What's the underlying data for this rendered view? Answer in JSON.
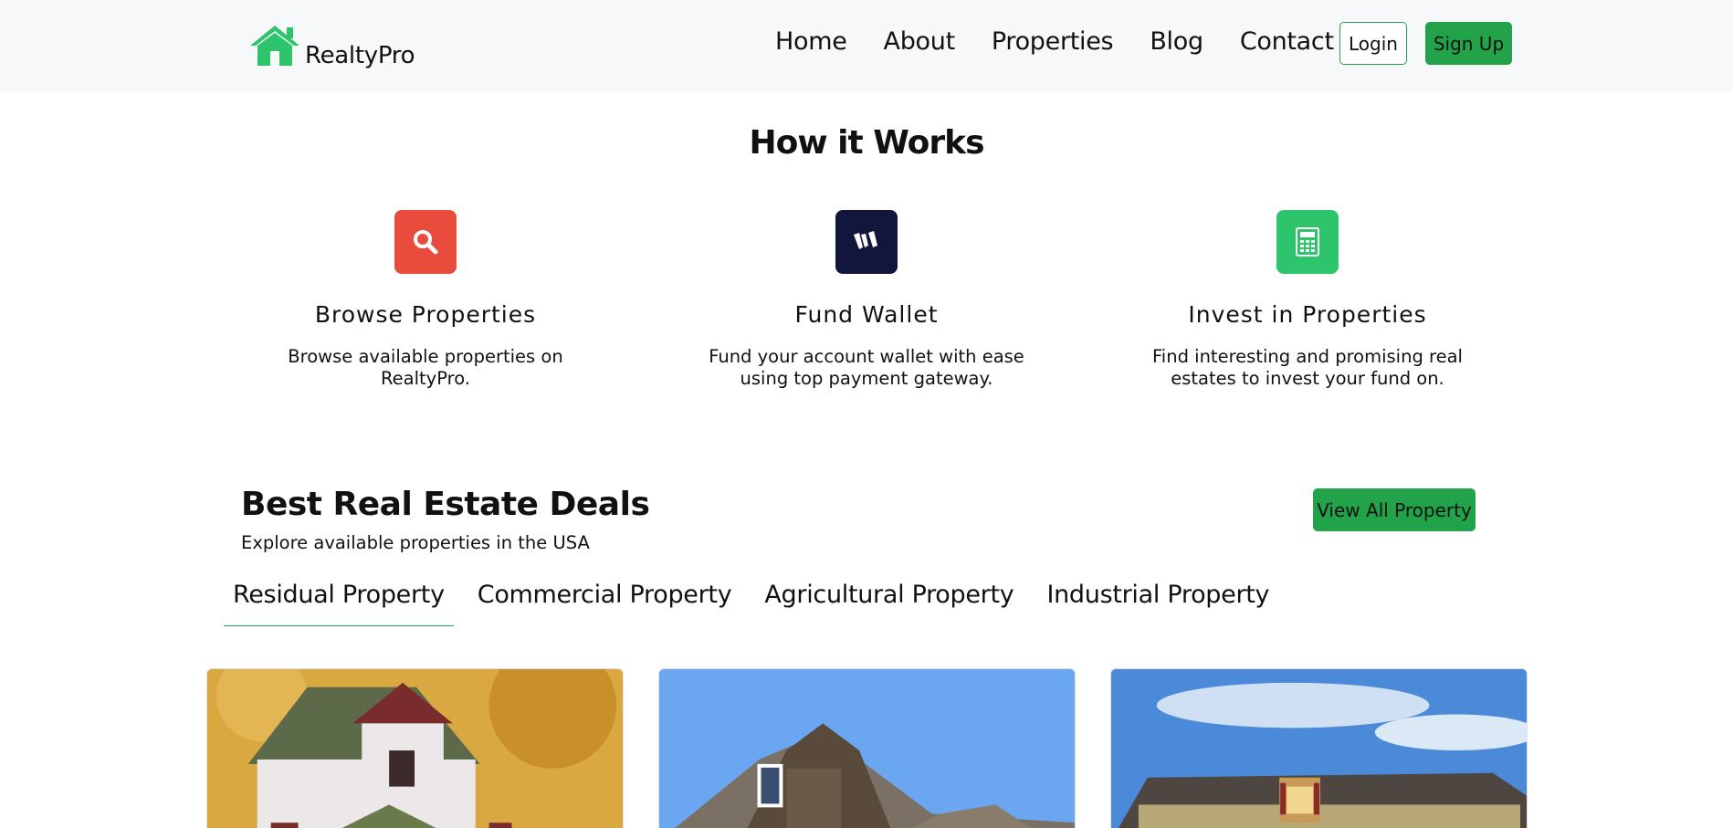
{
  "brand": {
    "name": "RealtyPro",
    "accent_color": "#22a34a",
    "logo_icon": "house-icon"
  },
  "nav": {
    "items": [
      "Home",
      "About",
      "Properties",
      "Blog",
      "Contact"
    ],
    "login_label": "Login",
    "signup_label": "Sign Up"
  },
  "how_it_works": {
    "title": "How it Works",
    "steps": [
      {
        "icon": "search-icon",
        "color": "#e94b3c",
        "title": "Browse Properties",
        "description": "Browse available properties on RealtyPro."
      },
      {
        "icon": "wallet-logo-icon",
        "color": "#12163a",
        "title": "Fund Wallet",
        "description": "Fund your account wallet with ease using top payment gateway."
      },
      {
        "icon": "calculator-icon",
        "color": "#2ec46c",
        "title": "Invest in Properties",
        "description": "Find interesting and promising real estates to invest your fund on."
      }
    ]
  },
  "deals": {
    "title": "Best Real Estate Deals",
    "subtitle": "Explore available properties in the USA",
    "view_all_label": "View All Property",
    "tabs": [
      "Residual Property",
      "Commercial Property",
      "Agricultural Property",
      "Industrial Property"
    ],
    "active_tab": "Residual Property"
  }
}
